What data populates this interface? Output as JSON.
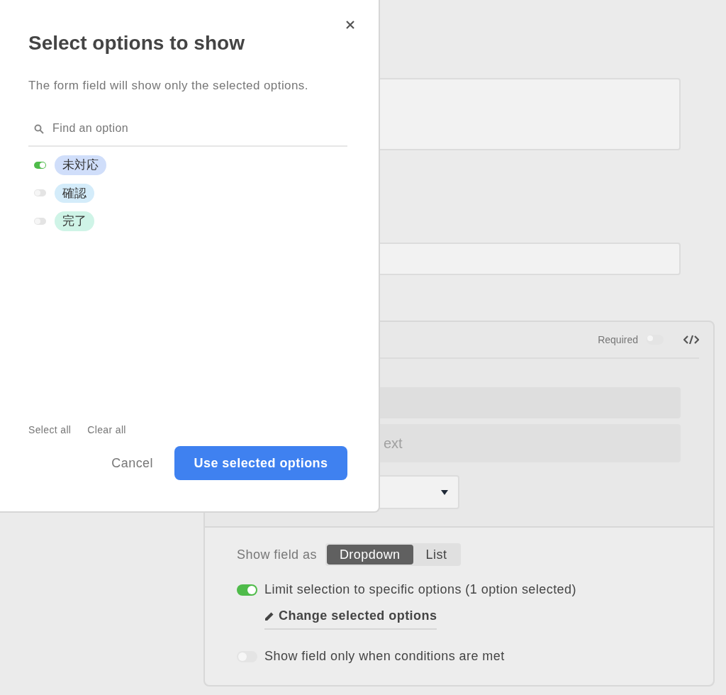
{
  "dialog": {
    "title": "Select options to show",
    "description": "The form field will show only the selected options.",
    "search": {
      "placeholder": "Find an option"
    },
    "options": [
      {
        "label": "未対応",
        "selected": true,
        "color": "#d0defa"
      },
      {
        "label": "確認",
        "selected": false,
        "color": "#d4ecfa"
      },
      {
        "label": "完了",
        "selected": false,
        "color": "#cff4e7"
      }
    ],
    "select_all": "Select all",
    "clear_all": "Clear all",
    "cancel": "Cancel",
    "confirm": "Use selected options"
  },
  "form": {
    "required": {
      "label": "Required",
      "on": false
    },
    "field_text": "ext",
    "show_field_as": {
      "label": "Show field as",
      "options": [
        {
          "label": "Dropdown",
          "selected": true
        },
        {
          "label": "List",
          "selected": false
        }
      ]
    },
    "settings": [
      {
        "label": "Limit selection to specific options (1 option selected)",
        "on": true,
        "link": "Change selected options"
      },
      {
        "label": "Show field only when conditions are met",
        "on": false
      }
    ]
  }
}
